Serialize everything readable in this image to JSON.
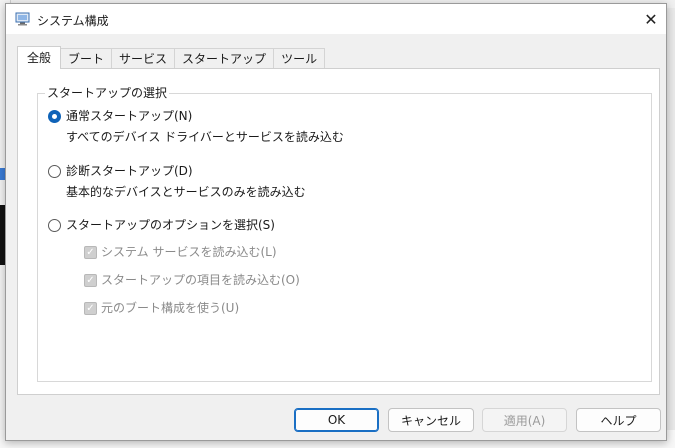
{
  "window": {
    "title": "システム構成",
    "close_glyph": "✕"
  },
  "tabs": [
    {
      "label": "全般",
      "active": true
    },
    {
      "label": "ブート",
      "active": false
    },
    {
      "label": "サービス",
      "active": false
    },
    {
      "label": "スタートアップ",
      "active": false
    },
    {
      "label": "ツール",
      "active": false
    }
  ],
  "startup_group": {
    "legend": "スタートアップの選択",
    "normal": {
      "label": "通常スタートアップ(N)",
      "description": "すべてのデバイス ドライバーとサービスを読み込む",
      "checked": true
    },
    "diagnostic": {
      "label": "診断スタートアップ(D)",
      "description": "基本的なデバイスとサービスのみを読み込む",
      "checked": false
    },
    "selective": {
      "label": "スタートアップのオプションを選択(S)",
      "checked": false,
      "options": [
        {
          "label": "システム サービスを読み込む(L)",
          "checked": true,
          "disabled": true
        },
        {
          "label": "スタートアップの項目を読み込む(O)",
          "checked": true,
          "disabled": true
        },
        {
          "label": "元のブート構成を使う(U)",
          "checked": true,
          "disabled": true
        }
      ]
    }
  },
  "buttons": {
    "ok": "OK",
    "cancel": "キャンセル",
    "apply": "適用(A)",
    "help": "ヘルプ"
  },
  "icons": {
    "title": "msconfig-icon",
    "close": "close-icon",
    "check": "check-icon"
  },
  "colors": {
    "accent": "#0f63b8",
    "dialog_bg": "#f0f0f0",
    "panel_bg": "#ffffff",
    "disabled_text": "#8a8a8a"
  }
}
